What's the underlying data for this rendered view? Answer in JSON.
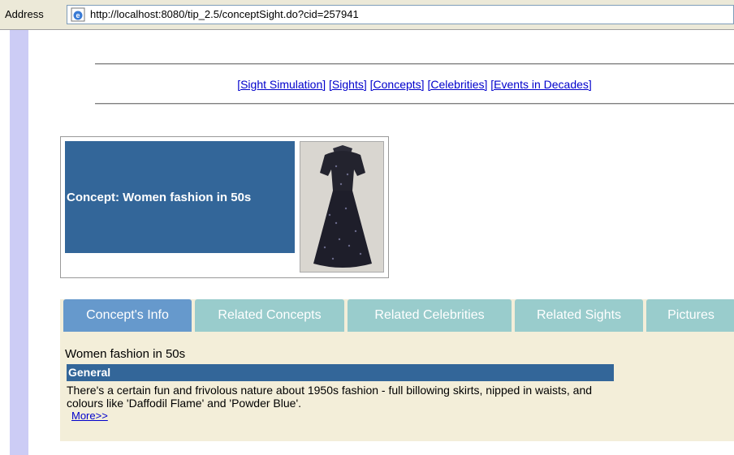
{
  "address_bar": {
    "label": "Address",
    "url": "http://localhost:8080/tip_2.5/conceptSight.do?cid=257941"
  },
  "nav": {
    "links": [
      "[Sight Simulation]",
      "[Sights]",
      "[Concepts]",
      "[Celebrities]",
      "[Events in Decades]"
    ]
  },
  "concept": {
    "title": "Concept: Women fashion in 50s",
    "name": "Women fashion in 50s"
  },
  "tabs": [
    "Concept's Info",
    "Related Concepts",
    "Related Celebrities",
    "Related Sights",
    "Pictures"
  ],
  "section": {
    "header": "General",
    "description": "There's a certain fun and frivolous nature about 1950s fashion - full billowing skirts, nipped in waists, and colours like 'Daffodil Flame' and 'Powder Blue'.",
    "more_label": "More>>"
  },
  "colors": {
    "title_bg": "#336699",
    "tab_active": "#6699cc",
    "tab_inactive": "#99cccc",
    "panel_bg": "#f3eed9",
    "left_strip": "#ccccf5"
  },
  "icons": {
    "address_icon": "ie-page-icon"
  }
}
